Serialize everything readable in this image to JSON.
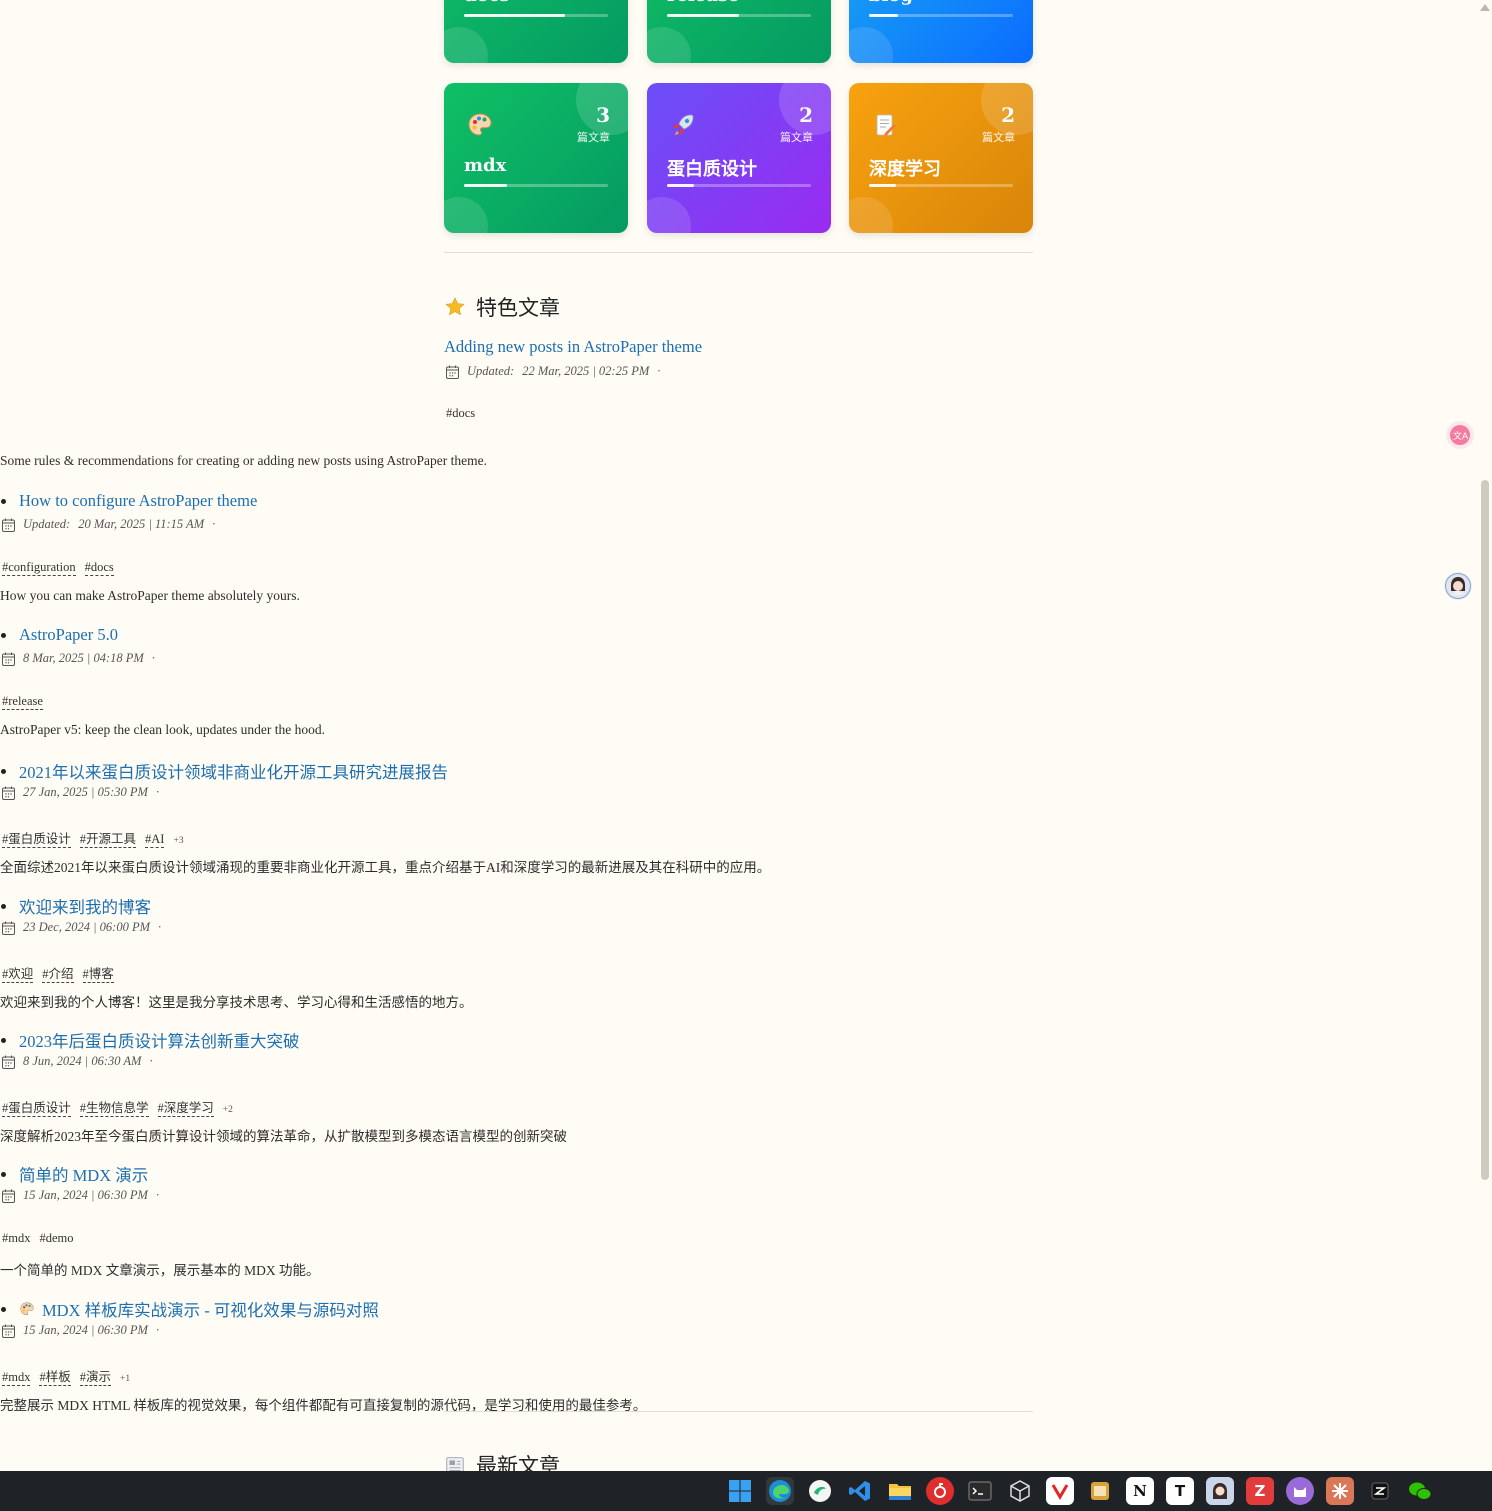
{
  "categories": [
    {
      "name": "docs",
      "count": "",
      "unit": "",
      "color": "green",
      "progress": 0.7
    },
    {
      "name": "release",
      "count": "",
      "unit": "",
      "color": "green",
      "progress": 0.5
    },
    {
      "name": "blog",
      "count": "",
      "unit": "",
      "color": "blue",
      "progress": 0.2
    },
    {
      "name": "mdx",
      "count": "3",
      "unit": "篇文章",
      "color": "green",
      "progress": 0.3,
      "icon": "palette-icon"
    },
    {
      "name": "蛋白质设计",
      "count": "2",
      "unit": "篇文章",
      "color": "purple",
      "progress": 0.19,
      "icon": "rocket-icon"
    },
    {
      "name": "深度学习",
      "count": "2",
      "unit": "篇文章",
      "color": "orange",
      "progress": 0.19,
      "icon": "memo-icon"
    }
  ],
  "featured": {
    "title": "特色文章",
    "first_post": {
      "title": "Adding new posts in AstroPaper theme",
      "date_label": "Updated:",
      "date": "22 Mar, 2025 | 02:25 PM",
      "sep": "·",
      "tags": [
        "docs"
      ],
      "description": "Some rules & recommendations for creating or adding new posts using AstroPaper theme."
    },
    "posts": [
      {
        "title": "How to configure AstroPaper theme",
        "date_label": "Updated:",
        "date": "20 Mar, 2025 | 11:15 AM",
        "sep": "·",
        "tags": [
          "configuration",
          "docs"
        ],
        "more": "",
        "description": "How you can make AstroPaper theme absolutely yours."
      },
      {
        "title": "AstroPaper 5.0",
        "date_label": "",
        "date": "8 Mar, 2025 | 04:18 PM",
        "sep": "·",
        "tags": [
          "release"
        ],
        "more": "",
        "description": "AstroPaper v5: keep the clean look, updates under the hood."
      },
      {
        "title": "2021年以来蛋白质设计领域非商业化开源工具研究进展报告",
        "date_label": "",
        "date": "27 Jan, 2025 | 05:30 PM",
        "sep": "·",
        "tags": [
          "蛋白质设计",
          "开源工具",
          "AI"
        ],
        "more": "+3",
        "description": "全面综述2021年以来蛋白质设计领域涌现的重要非商业化开源工具，重点介绍基于AI和深度学习的最新进展及其在科研中的应用。"
      },
      {
        "title": "欢迎来到我的博客",
        "date_label": "",
        "date": "23 Dec, 2024 | 06:00 PM",
        "sep": "·",
        "tags": [
          "欢迎",
          "介绍",
          "博客"
        ],
        "more": "",
        "description": "欢迎来到我的个人博客！这里是我分享技术思考、学习心得和生活感悟的地方。"
      },
      {
        "title": "2023年后蛋白质设计算法创新重大突破",
        "date_label": "",
        "date": "8 Jun, 2024 | 06:30 AM",
        "sep": "·",
        "tags": [
          "蛋白质设计",
          "生物信息学",
          "深度学习"
        ],
        "more": "+2",
        "description": "深度解析2023年至今蛋白质计算设计领域的算法革命，从扩散模型到多模态语言模型的创新突破"
      },
      {
        "title": "简单的 MDX 演示",
        "date_label": "",
        "date": "15 Jan, 2024 | 06:30 PM",
        "sep": "·",
        "tags": [
          "mdx",
          "demo"
        ],
        "more": "",
        "description": "一个简单的 MDX 文章演示，展示基本的 MDX 功能。"
      },
      {
        "title": "MDX 样板库实战演示 - 可视化效果与源码对照",
        "date_label": "",
        "date": "15 Jan, 2024 | 06:30 PM",
        "sep": "·",
        "tags": [
          "mdx",
          "样板",
          "演示"
        ],
        "more": "+1",
        "description": "完整展示 MDX HTML 样板库的视觉效果，每个组件都配有可直接复制的源代码，是学习和使用的最佳参考。"
      }
    ]
  },
  "latest": {
    "title": "最新文章"
  },
  "taskbar": {
    "apps": [
      "windows-start-icon",
      "edge-icon",
      "app-green-icon",
      "vscode-icon",
      "file-explorer-icon",
      "netease-music-icon",
      "terminal-icon",
      "unity-icon",
      "yandex-icon",
      "notes-icon",
      "notion-icon",
      "typora-icon",
      "avatar-app-icon",
      "zotero-icon",
      "cat-app-icon",
      "claude-icon",
      "app-black-icon",
      "wechat-icon"
    ]
  }
}
